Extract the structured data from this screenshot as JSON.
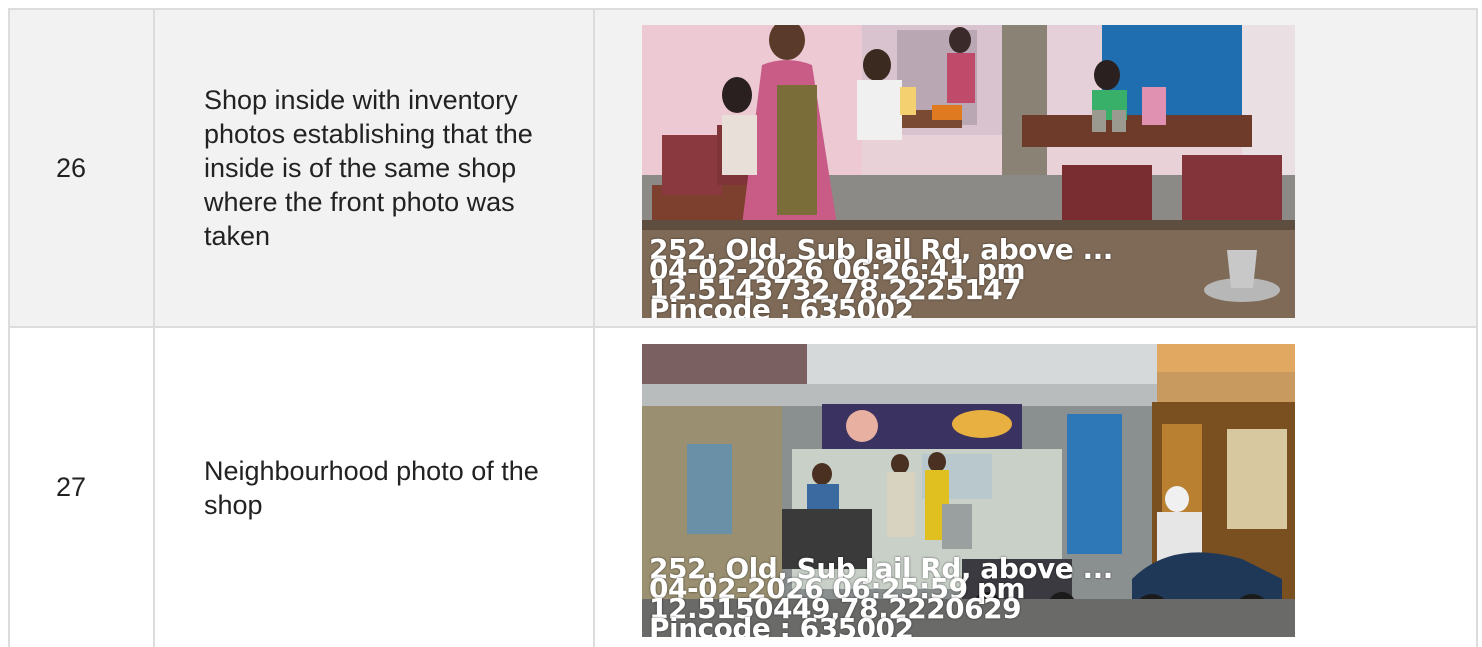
{
  "rows": [
    {
      "number": "26",
      "description": "Shop inside with inventory photos establishing that the inside is of the same shop where the front photo was taken",
      "photo": {
        "address": "252, Old, Sub Jail Rd, above ...",
        "datetime": "04-02-2026 06:26:41 pm",
        "coords": "12.5143732,78.2225147",
        "pincode": "Pincode : 635002"
      }
    },
    {
      "number": "27",
      "description": "Neighbourhood photo of the shop",
      "photo": {
        "address": "252, Old, Sub Jail Rd, above ...",
        "datetime": "04-02-2026 06:25:59 pm",
        "coords": "12.5150449,78.2220629",
        "pincode": "Pincode : 635002"
      }
    }
  ]
}
